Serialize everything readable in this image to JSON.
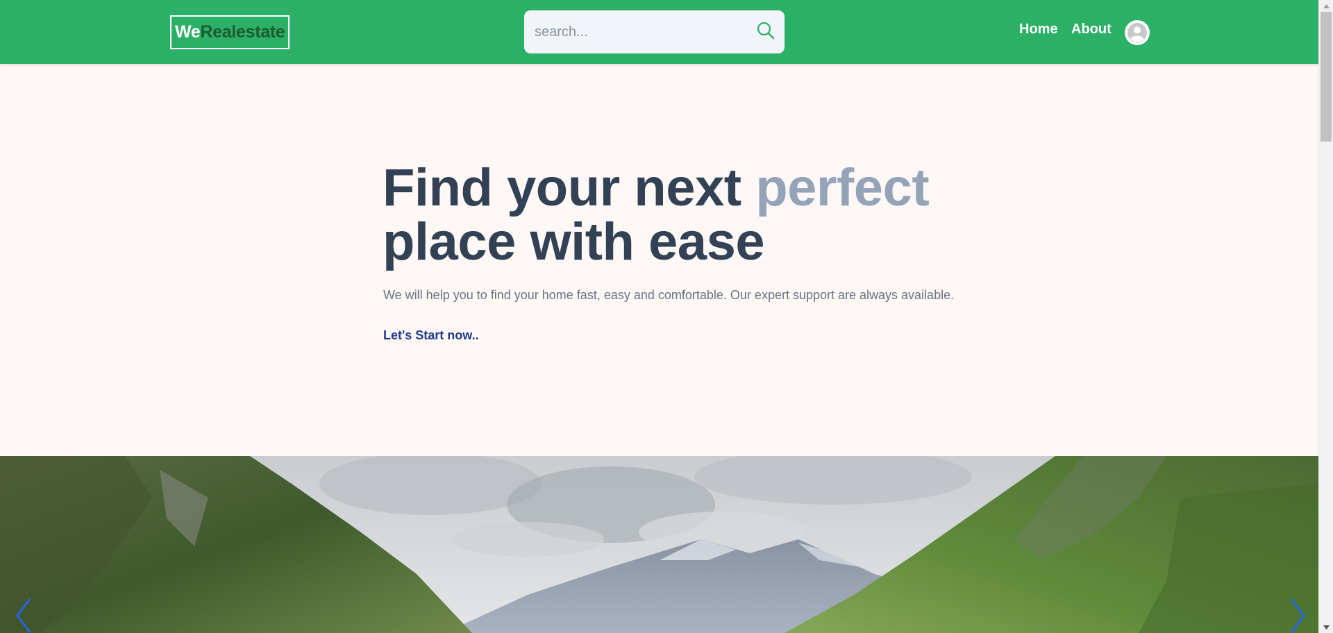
{
  "header": {
    "logo_primary": "We",
    "logo_secondary": "Realestate",
    "search_placeholder": "search...",
    "nav": [
      {
        "label": "Home"
      },
      {
        "label": "About"
      }
    ]
  },
  "hero": {
    "title_part1": "Find your next ",
    "title_accent": "perfect",
    "title_part2": "place with ease",
    "subtitle": "We will help you to find your home fast, easy and comfortable. Our expert support are always available.",
    "cta_label": "Let's Start now.."
  },
  "colors": {
    "header_bg": "#2bb066",
    "page_bg": "#fdf8f6",
    "title": "#334155",
    "title_accent": "#94a3b8",
    "cta": "#1e3a8a",
    "slider_arrows": "#2563eb"
  },
  "icons": {
    "search": "search-icon",
    "avatar": "user-avatar-icon",
    "prev": "chevron-left-icon",
    "next": "chevron-right-icon"
  }
}
